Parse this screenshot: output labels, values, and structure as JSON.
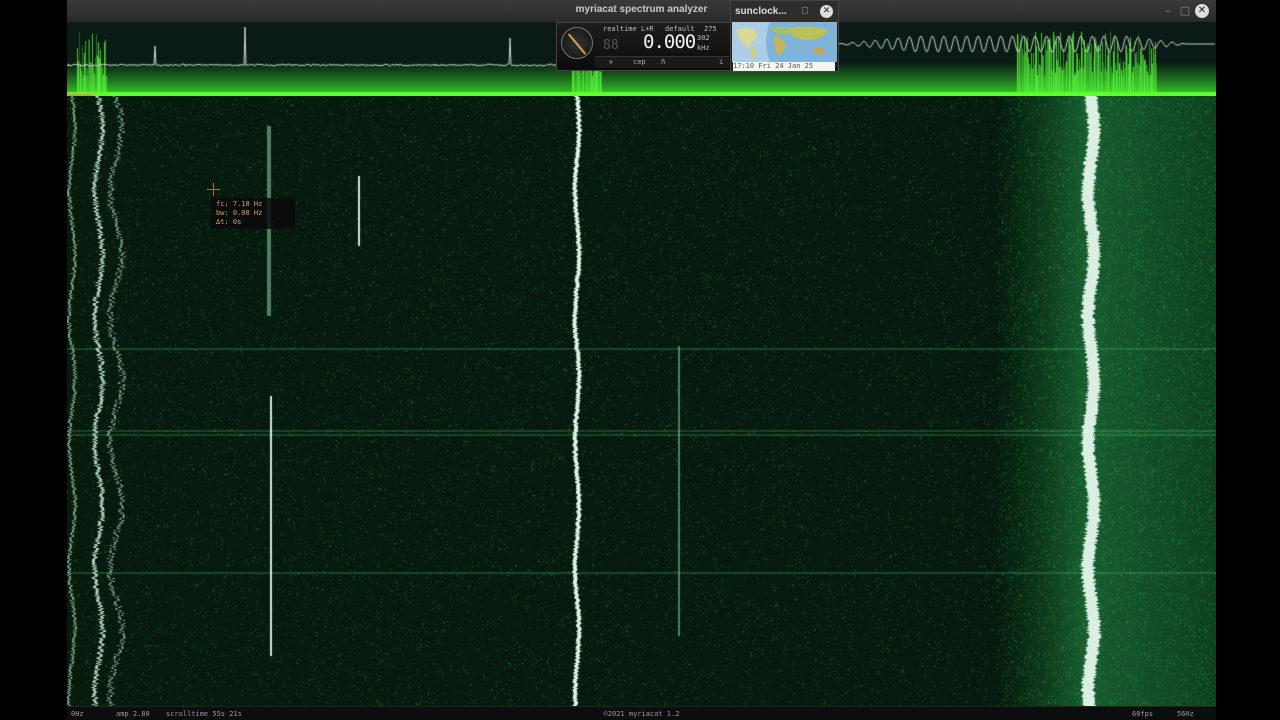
{
  "app": {
    "title": "myriacat spectrum analyzer",
    "window_controls": {
      "minimize": "–",
      "maximize": "□",
      "close": "✕"
    }
  },
  "widget": {
    "mode": "realtime",
    "channels": "L+R",
    "preset": "default",
    "rate_top": "275",
    "indicator": "88",
    "frequency": "0.000",
    "frequency_aux": "302",
    "frequency_unit": "kHz",
    "buttons": {
      "down": "⩔",
      "cep": "cep",
      "filter": "ñ",
      "info": "i"
    },
    "dial_icon": "knob-icon"
  },
  "sunclock": {
    "title": "sunclock...",
    "maximize": "□",
    "close": "✕",
    "date": "17:10 Fri 24 Jan 25"
  },
  "cursor": {
    "fc": "fc: 7.18 Hz",
    "bw": "bw: 0.00 Hz",
    "dt": "Δt: 0s"
  },
  "status": {
    "freq_start": "0Hz",
    "amp": "amp 2.80",
    "scrolltime": "scrolltime 55s 21s",
    "copyright": "©2021 myriacat 1.2",
    "fps": "60fps",
    "freq_end": "56Hz"
  },
  "colors": {
    "waterfall_bg": "#061208",
    "waterfall_signal": "#2fbf5a",
    "spectrum_line": "#8dff4a",
    "cursor": "#e05050",
    "cursor_text": "#d9a060"
  }
}
